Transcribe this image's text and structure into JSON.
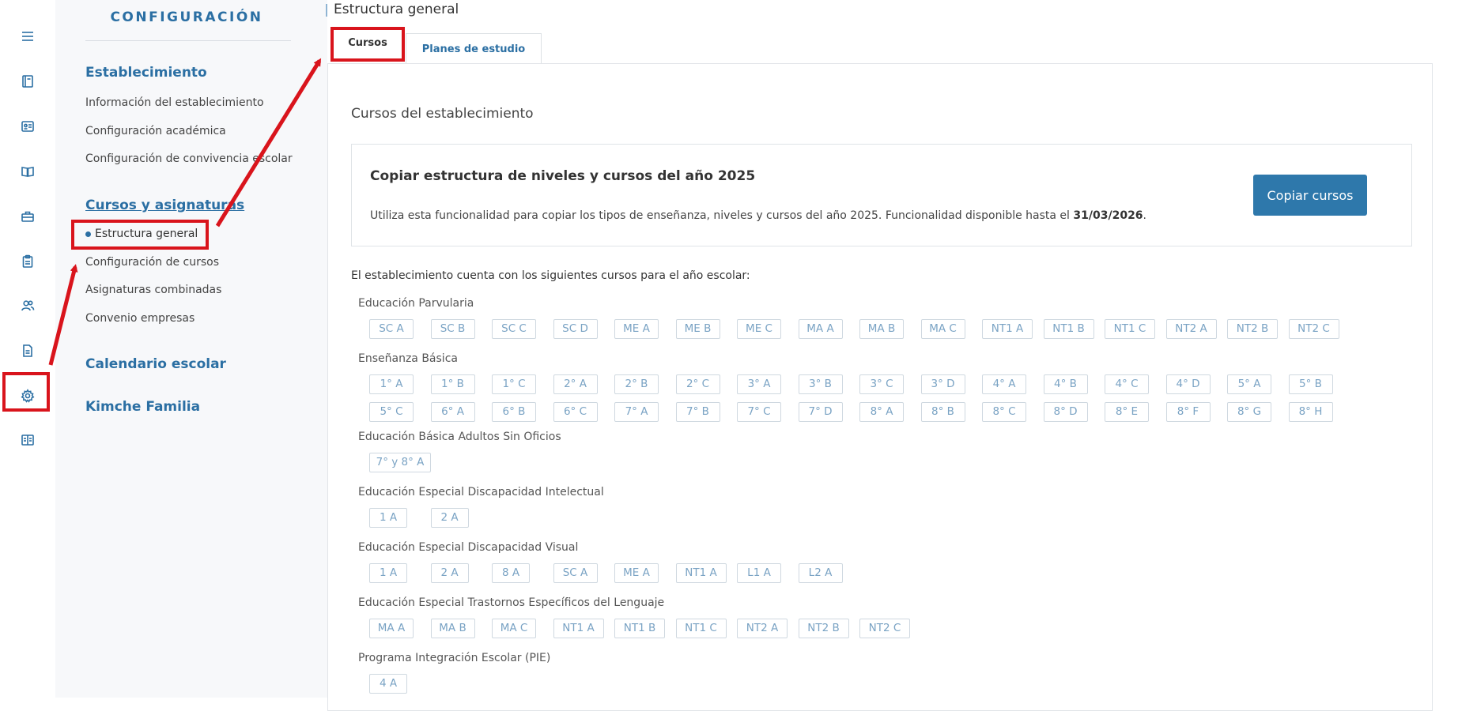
{
  "rail": {
    "icons": [
      "menu-icon",
      "book-icon",
      "id-card-icon",
      "open-book-icon",
      "briefcase-icon",
      "clipboard-icon",
      "users-icon",
      "document-icon",
      "gear-icon",
      "reader-icon"
    ]
  },
  "config": {
    "title": "CONFIGURACIÓN",
    "sections": [
      {
        "label": "Establecimiento",
        "items": [
          "Información del establecimiento",
          "Configuración académica",
          "Configuración de convivencia escolar"
        ]
      },
      {
        "label": "Cursos y asignaturas",
        "items": [
          "Estructura general",
          "Configuración de cursos",
          "Asignaturas combinadas",
          "Convenio empresas"
        ]
      },
      {
        "label": "Calendario escolar",
        "items": []
      },
      {
        "label": "Kimche Familia",
        "items": []
      }
    ]
  },
  "main": {
    "page_title": "Estructura general",
    "tabs": [
      "Cursos",
      "Planes de estudio"
    ],
    "section_title": "Cursos del establecimiento",
    "copy": {
      "title": "Copiar estructura de niveles y cursos del año 2025",
      "desc_prefix": "Utiliza esta funcionalidad para copiar los tipos de enseñanza, niveles y cursos del año 2025. Funcionalidad disponible hasta el ",
      "desc_date": "31/03/2026",
      "desc_suffix": ".",
      "button": "Copiar cursos"
    },
    "intro": "El establecimiento cuenta con los siguientes cursos para el año escolar:",
    "groups": [
      {
        "label": "Educación Parvularia",
        "rows": [
          [
            "SC A",
            "SC B",
            "SC C",
            "SC D",
            "ME A",
            "ME B",
            "ME C",
            "MA A",
            "MA B",
            "MA C",
            "NT1 A",
            "NT1 B",
            "NT1 C",
            "NT2 A",
            "NT2 B",
            "NT2 C"
          ]
        ]
      },
      {
        "label": "Enseñanza Básica",
        "rows": [
          [
            "1° A",
            "1° B",
            "1° C",
            "2° A",
            "2° B",
            "2° C",
            "3° A",
            "3° B",
            "3° C",
            "3° D",
            "4° A",
            "4° B",
            "4° C",
            "4° D",
            "5° A",
            "5° B"
          ],
          [
            "5° C",
            "6° A",
            "6° B",
            "6° C",
            "7° A",
            "7° B",
            "7° C",
            "7° D",
            "8° A",
            "8° B",
            "8° C",
            "8° D",
            "8° E",
            "8° F",
            "8° G",
            "8° H"
          ]
        ]
      },
      {
        "label": "Educación Básica Adultos Sin Oficios",
        "rows": [
          [
            "7° y 8° A"
          ]
        ]
      },
      {
        "label": "Educación Especial Discapacidad Intelectual",
        "rows": [
          [
            "1 A",
            "2 A"
          ]
        ]
      },
      {
        "label": "Educación Especial Discapacidad Visual",
        "rows": [
          [
            "1 A",
            "2 A",
            "8 A",
            "SC A",
            "ME A",
            "NT1 A",
            "L1 A",
            "L2 A"
          ]
        ]
      },
      {
        "label": "Educación Especial Trastornos Específicos del Lenguaje",
        "rows": [
          [
            "MA A",
            "MA B",
            "MA C",
            "NT1 A",
            "NT1 B",
            "NT1 C",
            "NT2 A",
            "NT2 B",
            "NT2 C"
          ]
        ]
      },
      {
        "label": "Programa Integración Escolar (PIE)",
        "rows": [
          [
            "4 A"
          ]
        ]
      }
    ]
  }
}
